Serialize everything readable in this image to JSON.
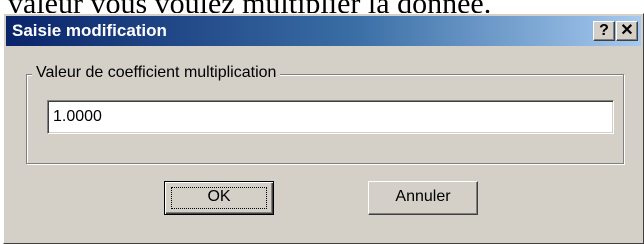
{
  "background_text": "valeur vous voulez multiplier la donnée.",
  "dialog": {
    "title": "Saisie modification",
    "help_button": "?",
    "close_button": "✕",
    "group": {
      "label": "Valeur de coefficient multiplication",
      "value_field": {
        "value": "1.0000"
      }
    },
    "buttons": {
      "ok": "OK",
      "cancel": "Annuler"
    }
  },
  "colors": {
    "dialog_face": "#d4d0c8",
    "title_gradient_start": "#0a246a",
    "title_gradient_end": "#a6caf0"
  }
}
